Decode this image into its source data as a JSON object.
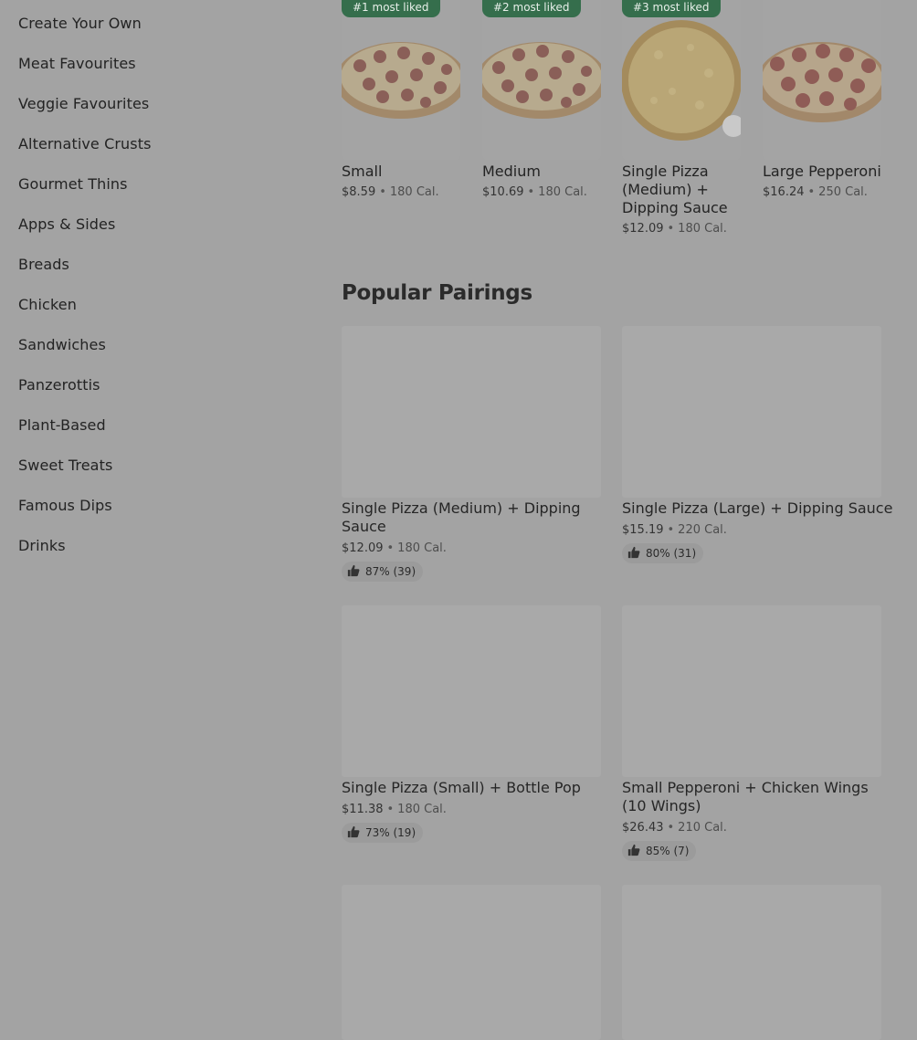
{
  "categories": [
    "Create Your Own",
    "Meat Favourites",
    "Veggie Favourites",
    "Alternative Crusts",
    "Gourmet Thins",
    "Apps & Sides",
    "Breads",
    "Chicken",
    "Sandwiches",
    "Panzerottis",
    "Plant-Based",
    "Sweet Treats",
    "Famous Dips",
    "Drinks"
  ],
  "most_liked": [
    {
      "badge": "#1 most liked",
      "title": "Small",
      "price": "$8.59",
      "cal": "180 Cal.",
      "image": "pepperoni-pizza-image"
    },
    {
      "badge": "#2 most liked",
      "title": "Medium",
      "price": "$10.69",
      "cal": "180 Cal.",
      "image": "pepperoni-pizza-image"
    },
    {
      "badge": "#3 most liked",
      "title": "Single Pizza (Medium) + Dipping Sauce",
      "price": "$12.09",
      "cal": "180 Cal.",
      "image": "cheese-pizza-image"
    },
    {
      "badge": "",
      "title": "Large Pepperoni",
      "price": "$16.24",
      "cal": "250 Cal.",
      "image": "pepperoni-pizza-image"
    }
  ],
  "section": {
    "title": "Popular Pairings"
  },
  "pairings": [
    {
      "title": "Single Pizza (Medium) + Dipping Sauce",
      "price": "$12.09",
      "cal": "180 Cal.",
      "rating": "87% (39)"
    },
    {
      "title": "Single Pizza (Large) + Dipping Sauce",
      "price": "$15.19",
      "cal": "220 Cal.",
      "rating": "80% (31)"
    },
    {
      "title": "Single Pizza (Small) + Bottle Pop",
      "price": "$11.38",
      "cal": "180 Cal.",
      "rating": "73% (19)"
    },
    {
      "title": "Small Pepperoni + Chicken Wings (10 Wings)",
      "price": "$26.43",
      "cal": "210 Cal.",
      "rating": "85% (7)"
    }
  ],
  "meta_separator": "•",
  "colors": {
    "overlay": "#a3a3a3",
    "badge": "#356e4c",
    "text": "#232323"
  },
  "icons": {
    "rating": "thumbs-up-icon"
  }
}
